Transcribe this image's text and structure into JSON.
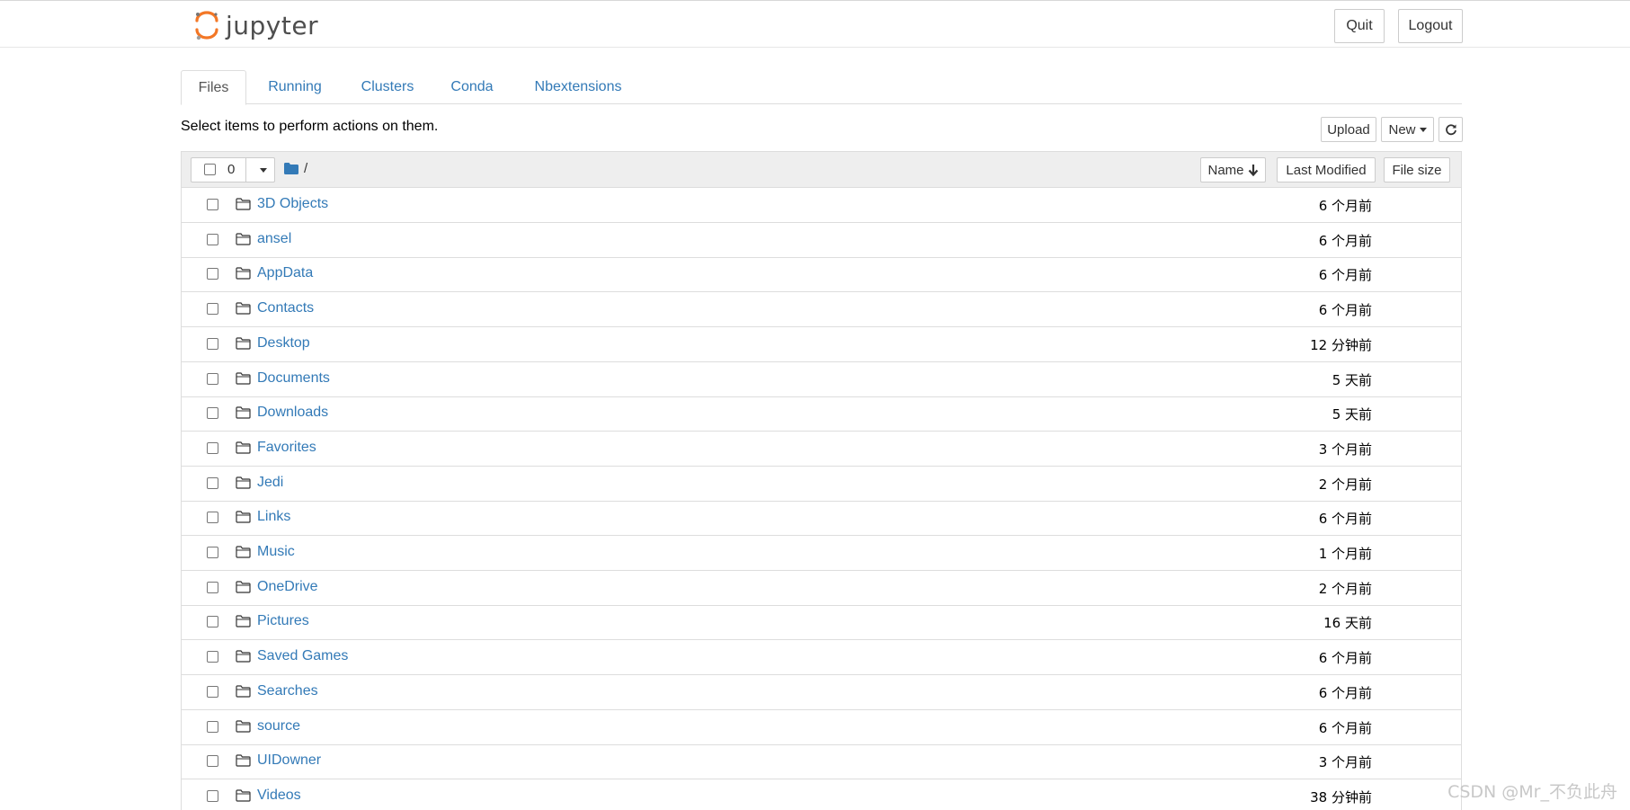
{
  "app": {
    "logo_text": "jupyter"
  },
  "header": {
    "quit_label": "Quit",
    "logout_label": "Logout"
  },
  "tabs": [
    {
      "label": "Files",
      "active": true
    },
    {
      "label": "Running"
    },
    {
      "label": "Clusters"
    },
    {
      "label": "Conda"
    },
    {
      "label": "Nbextensions"
    }
  ],
  "toolbar": {
    "instructions": "Select items to perform actions on them.",
    "upload_label": "Upload",
    "new_label": "New"
  },
  "list_header": {
    "selected_count": "0",
    "breadcrumb": "/",
    "sort_name_label": "Name",
    "sort_modified_label": "Last Modified",
    "sort_size_label": "File size"
  },
  "files": [
    {
      "name": "3D Objects",
      "modified": "6 个月前"
    },
    {
      "name": "ansel",
      "modified": "6 个月前"
    },
    {
      "name": "AppData",
      "modified": "6 个月前"
    },
    {
      "name": "Contacts",
      "modified": "6 个月前"
    },
    {
      "name": "Desktop",
      "modified": "12 分钟前"
    },
    {
      "name": "Documents",
      "modified": "5 天前"
    },
    {
      "name": "Downloads",
      "modified": "5 天前"
    },
    {
      "name": "Favorites",
      "modified": "3 个月前"
    },
    {
      "name": "Jedi",
      "modified": "2 个月前"
    },
    {
      "name": "Links",
      "modified": "6 个月前"
    },
    {
      "name": "Music",
      "modified": "1 个月前"
    },
    {
      "name": "OneDrive",
      "modified": "2 个月前"
    },
    {
      "name": "Pictures",
      "modified": "16 天前"
    },
    {
      "name": "Saved Games",
      "modified": "6 个月前"
    },
    {
      "name": "Searches",
      "modified": "6 个月前"
    },
    {
      "name": "source",
      "modified": "6 个月前"
    },
    {
      "name": "UIDowner",
      "modified": "3 个月前"
    },
    {
      "name": "Videos",
      "modified": "38 分钟前"
    }
  ],
  "watermark": "CSDN @Mr_不负此舟",
  "colors": {
    "link": "#337ab7",
    "logo_orange": "#f37726",
    "header_bg": "#eeeeee"
  },
  "icons": [
    "jupyter-logo-icon",
    "folder-icon",
    "folder-open-icon",
    "sort-arrow-down-icon",
    "refresh-icon",
    "caret-down-icon"
  ]
}
